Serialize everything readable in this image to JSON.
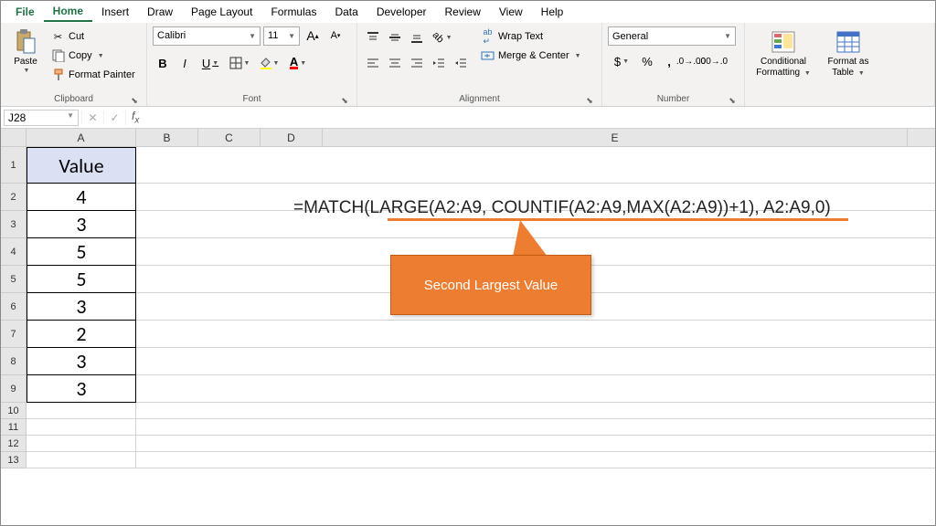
{
  "menu": {
    "file": "File",
    "home": "Home",
    "insert": "Insert",
    "draw": "Draw",
    "pageLayout": "Page Layout",
    "formulas": "Formulas",
    "data": "Data",
    "developer": "Developer",
    "review": "Review",
    "view": "View",
    "help": "Help"
  },
  "ribbon": {
    "clipboard": {
      "paste": "Paste",
      "cut": "Cut",
      "copy": "Copy",
      "painter": "Format Painter",
      "label": "Clipboard"
    },
    "font": {
      "name": "Calibri",
      "size": "11",
      "label": "Font"
    },
    "alignment": {
      "wrap": "Wrap Text",
      "merge": "Merge & Center",
      "label": "Alignment"
    },
    "number": {
      "format": "General",
      "label": "Number"
    },
    "styles": {
      "cond": "Conditional",
      "cond2": "Formatting",
      "fmt": "Format as",
      "fmt2": "Table"
    }
  },
  "formulaBar": {
    "ref": "J28",
    "value": ""
  },
  "columns": {
    "A": "A",
    "B": "B",
    "C": "C",
    "D": "D",
    "E": "E"
  },
  "sheet": {
    "header": "Value",
    "rows": [
      "4",
      "3",
      "5",
      "5",
      "3",
      "2",
      "3",
      "3"
    ]
  },
  "overlay": {
    "formula": "=MATCH(LARGE(A2:A9, COUNTIF(A2:A9,MAX(A2:A9))+1), A2:A9,0)",
    "callout": "Second Largest Value"
  },
  "chart_data": {
    "type": "table",
    "title": "Value",
    "categories": [
      "Row2",
      "Row3",
      "Row4",
      "Row5",
      "Row6",
      "Row7",
      "Row8",
      "Row9"
    ],
    "values": [
      4,
      3,
      5,
      5,
      3,
      2,
      3,
      3
    ]
  }
}
